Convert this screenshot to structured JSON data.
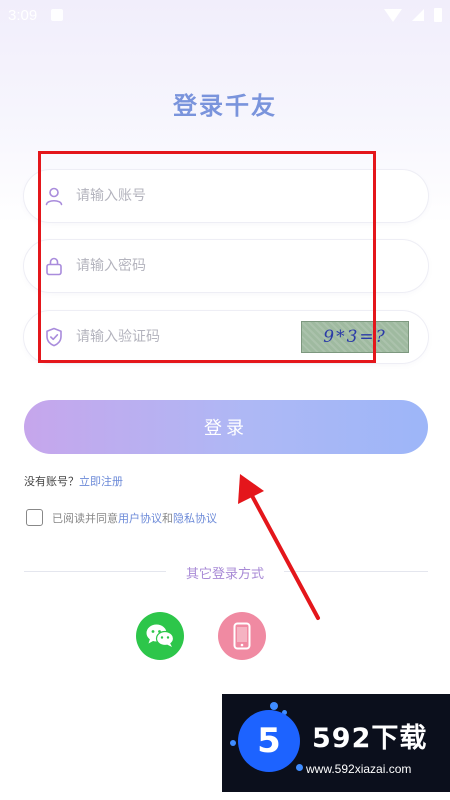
{
  "status_bar": {
    "time": "3:09"
  },
  "title": "登录千友",
  "fields": {
    "account": {
      "placeholder": "请输入账号",
      "icon": "user-icon"
    },
    "password": {
      "placeholder": "请输入密码",
      "icon": "lock-icon"
    },
    "captcha": {
      "placeholder": "请输入验证码",
      "icon": "shield-check-icon",
      "image_text": "9*3=?"
    }
  },
  "login_button": "登录",
  "register": {
    "prompt": "没有账号？",
    "link": "立即注册"
  },
  "agreement": {
    "prefix": "已阅读并同意",
    "user_agreement": "用户协议",
    "and": "和",
    "privacy_policy": "隐私协议"
  },
  "other_login": {
    "label": "其它登录方式",
    "methods": [
      {
        "name": "wechat",
        "icon": "wechat-icon",
        "color": "#2dc64a"
      },
      {
        "name": "phone",
        "icon": "phone-icon",
        "color": "#f08aa2"
      }
    ]
  },
  "colors": {
    "accent": "#7a94dc",
    "annotation": "#e4161b"
  },
  "watermark": {
    "brand": "592下载",
    "logo_digit": "5",
    "url": "www.592xiazai.com"
  }
}
